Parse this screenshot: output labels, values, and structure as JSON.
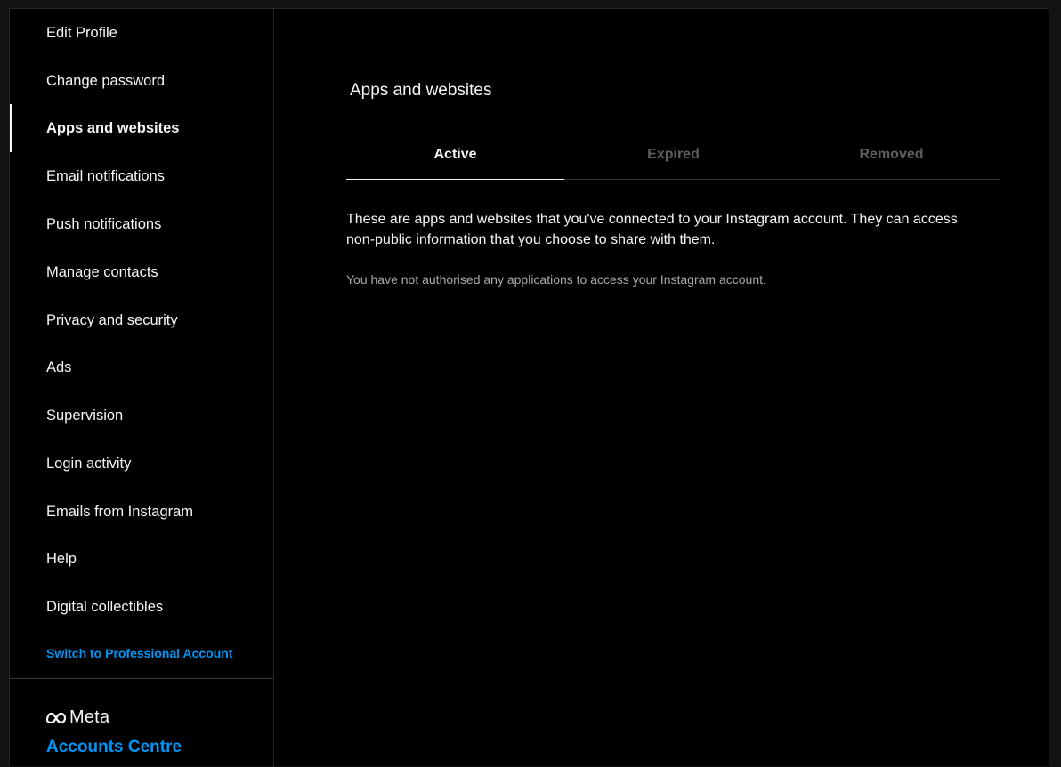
{
  "sidebar": {
    "items": [
      {
        "label": "Edit Profile",
        "active": false
      },
      {
        "label": "Change password",
        "active": false
      },
      {
        "label": "Apps and websites",
        "active": true
      },
      {
        "label": "Email notifications",
        "active": false
      },
      {
        "label": "Push notifications",
        "active": false
      },
      {
        "label": "Manage contacts",
        "active": false
      },
      {
        "label": "Privacy and security",
        "active": false
      },
      {
        "label": "Ads",
        "active": false
      },
      {
        "label": "Supervision",
        "active": false
      },
      {
        "label": "Login activity",
        "active": false
      },
      {
        "label": "Emails from Instagram",
        "active": false
      },
      {
        "label": "Help",
        "active": false
      },
      {
        "label": "Digital collectibles",
        "active": false
      }
    ],
    "switch_account_label": "Switch to Professional Account",
    "meta_brand": "Meta",
    "accounts_centre_label": "Accounts Centre"
  },
  "main": {
    "title": "Apps and websites",
    "tabs": [
      {
        "label": "Active",
        "active": true
      },
      {
        "label": "Expired",
        "active": false
      },
      {
        "label": "Removed",
        "active": false
      }
    ],
    "description": "These are apps and websites that you've connected to your Instagram account. They can access non-public information that you choose to share with them.",
    "empty_message": "You have not authorised any applications to access your Instagram account."
  },
  "colors": {
    "background": "#000000",
    "text": "#f5f5f5",
    "link": "#0095f6",
    "muted": "#a8a8a8",
    "inactive_tab": "#5e5e5e",
    "border": "#262626"
  },
  "icons": {
    "meta_logo": "meta-infinity-icon"
  }
}
